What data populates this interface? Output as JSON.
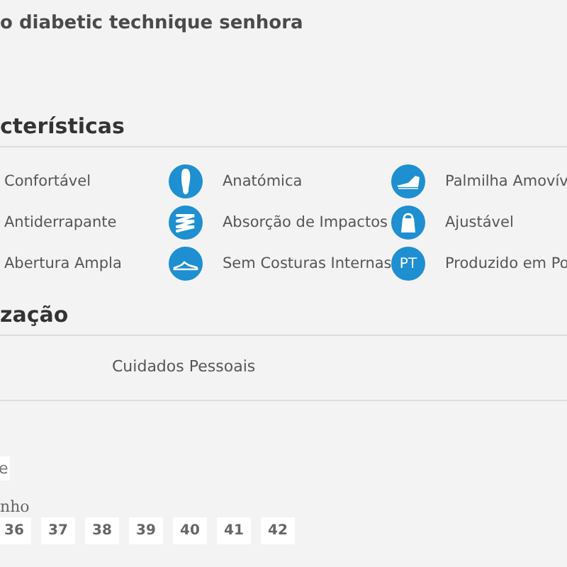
{
  "title": "o diabetic technique senhora",
  "features_heading": "cterísticas",
  "features": [
    {
      "label": "Confortável"
    },
    {
      "label": "Anatómica",
      "kind": "sole"
    },
    {
      "label": "Palmilha Amovív",
      "kind": "insole-shoe"
    },
    {
      "label": "Antiderrapante"
    },
    {
      "label": "Absorção de Impactos",
      "kind": "spring"
    },
    {
      "label": "Ajustável",
      "kind": "bag"
    },
    {
      "label": "Abertura Ampla"
    },
    {
      "label": "Sem Costuras Internas",
      "kind": "shoe"
    },
    {
      "label": "Produzido em Po",
      "kind": "badge",
      "badge": "PT"
    }
  ],
  "usage_heading": "zação",
  "usage_value": "Cuidados Pessoais",
  "color_option": "e",
  "size_label": "nho",
  "sizes": [
    "36",
    "37",
    "38",
    "39",
    "40",
    "41",
    "42"
  ]
}
